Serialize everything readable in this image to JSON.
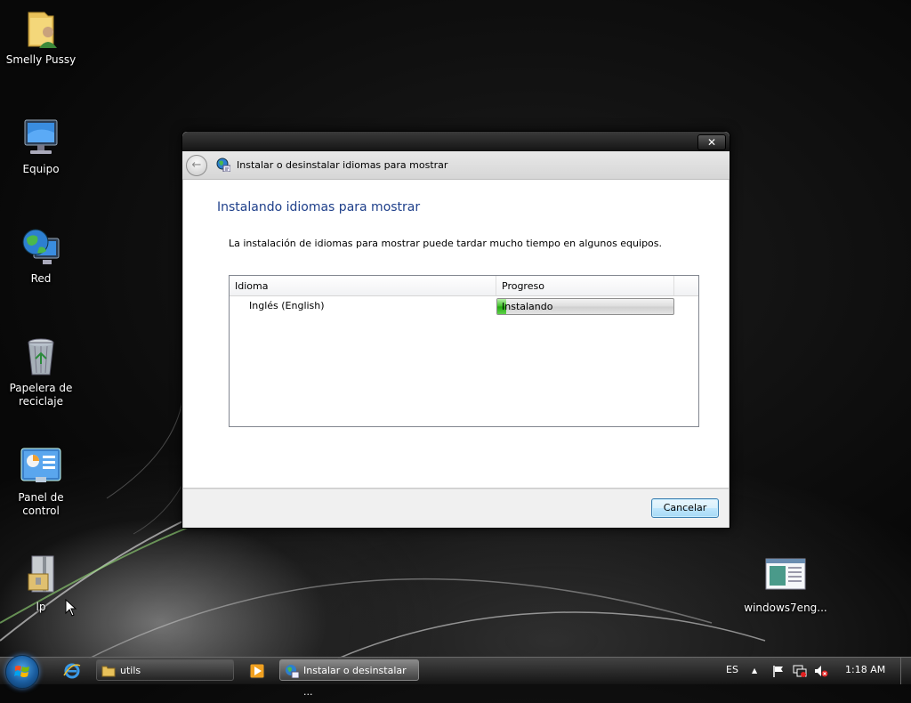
{
  "desktop": {
    "icons": [
      {
        "label": "Smelly Pussy",
        "icon": "user-folder-icon"
      },
      {
        "label": "Equipo",
        "icon": "computer-icon"
      },
      {
        "label": "Red",
        "icon": "network-globe-icon"
      },
      {
        "label": "Papelera de reciclaje",
        "icon": "recycle-bin-icon"
      },
      {
        "label": "Panel de control",
        "icon": "control-panel-icon"
      },
      {
        "label": "lp",
        "icon": "zip-archive-icon"
      },
      {
        "label": "windows7eng...",
        "icon": "document-file-icon"
      }
    ]
  },
  "window": {
    "nav_title": "Instalar o desinstalar idiomas para mostrar",
    "close_glyph": "✕",
    "back_glyph": "←",
    "heading": "Instalando idiomas para mostrar",
    "description": "La instalación de idiomas para mostrar puede tardar mucho tiempo en algunos equipos.",
    "list": {
      "columns": [
        "Idioma",
        "Progreso"
      ],
      "rows": [
        {
          "language": "Inglés (English)",
          "status": "Instalando",
          "progress_fraction": 0.05
        }
      ]
    },
    "cancel_label": "Cancelar"
  },
  "taskbar": {
    "tasks": [
      {
        "label": "utils",
        "icon": "folder-icon",
        "active": false
      },
      {
        "label": "Instalar o desinstalar ...",
        "icon": "language-icon",
        "active": true
      }
    ],
    "language_indicator": "ES",
    "clock": "1:18 AM",
    "show_hidden_glyph": "▲"
  }
}
